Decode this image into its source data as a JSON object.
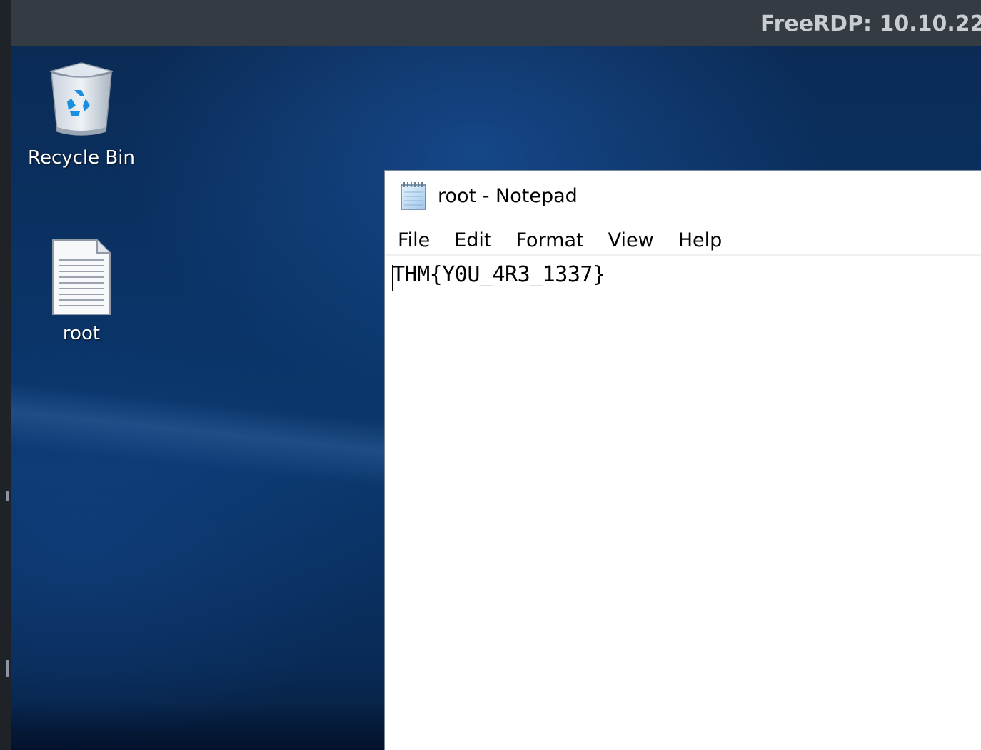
{
  "rdp_window": {
    "title": "FreeRDP: 10.10.22"
  },
  "desktop": {
    "icons": [
      {
        "label": "Recycle Bin",
        "icon": "recycle-bin-icon"
      },
      {
        "label": "root",
        "icon": "text-document-icon"
      }
    ]
  },
  "notepad": {
    "title": "root - Notepad",
    "icon": "notepad-icon",
    "menu": [
      "File",
      "Edit",
      "Format",
      "View",
      "Help"
    ],
    "content": "THM{Y0U_4R3_1337}"
  }
}
